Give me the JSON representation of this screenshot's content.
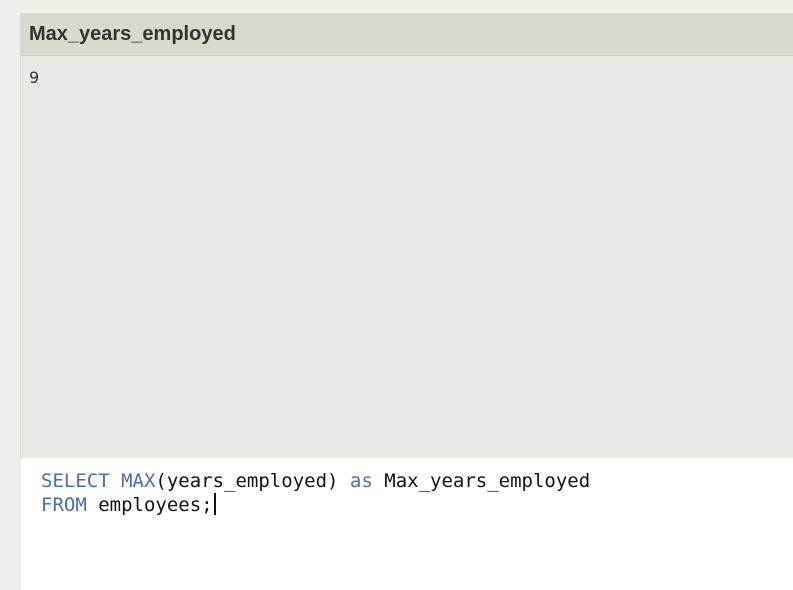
{
  "results": {
    "columns": [
      "Max_years_employed"
    ],
    "rows": [
      [
        "9"
      ]
    ]
  },
  "editor": {
    "line1": {
      "kw_select": "SELECT",
      "kw_max": "MAX",
      "fn_args": "(years_employed)",
      "kw_as": "as",
      "alias": "Max_years_employed"
    },
    "line2": {
      "kw_from": "FROM",
      "table": "employees;"
    }
  },
  "colors": {
    "keyword": "#4a6fa5",
    "header_bg": "#d8d8cd",
    "results_bg": "#e9e9e3",
    "editor_bg": "#ffffff"
  }
}
